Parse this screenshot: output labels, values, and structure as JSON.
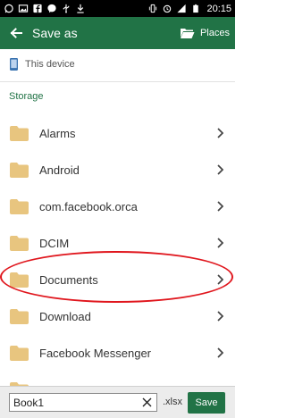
{
  "status_bar": {
    "time": "20:15",
    "icons_left": [
      "whatsapp-icon",
      "image-icon",
      "facebook-icon",
      "messenger-icon",
      "usb-icon",
      "download-icon"
    ],
    "icons_right": [
      "vibrate-icon",
      "alarm-icon",
      "signal-icon",
      "battery-icon"
    ]
  },
  "app_bar": {
    "title": "Save as",
    "places_label": "Places",
    "color": "#217346"
  },
  "device": {
    "label": "This device"
  },
  "section": {
    "title": "Storage"
  },
  "folders": [
    {
      "label": "Alarms"
    },
    {
      "label": "Android"
    },
    {
      "label": "com.facebook.orca"
    },
    {
      "label": "DCIM"
    },
    {
      "label": "Documents"
    },
    {
      "label": "Download"
    },
    {
      "label": "Facebook Messenger"
    }
  ],
  "bottom_bar": {
    "filename_value": "Book1",
    "extension": ".xlsx",
    "save_label": "Save"
  },
  "highlight_color": "#e0161d"
}
